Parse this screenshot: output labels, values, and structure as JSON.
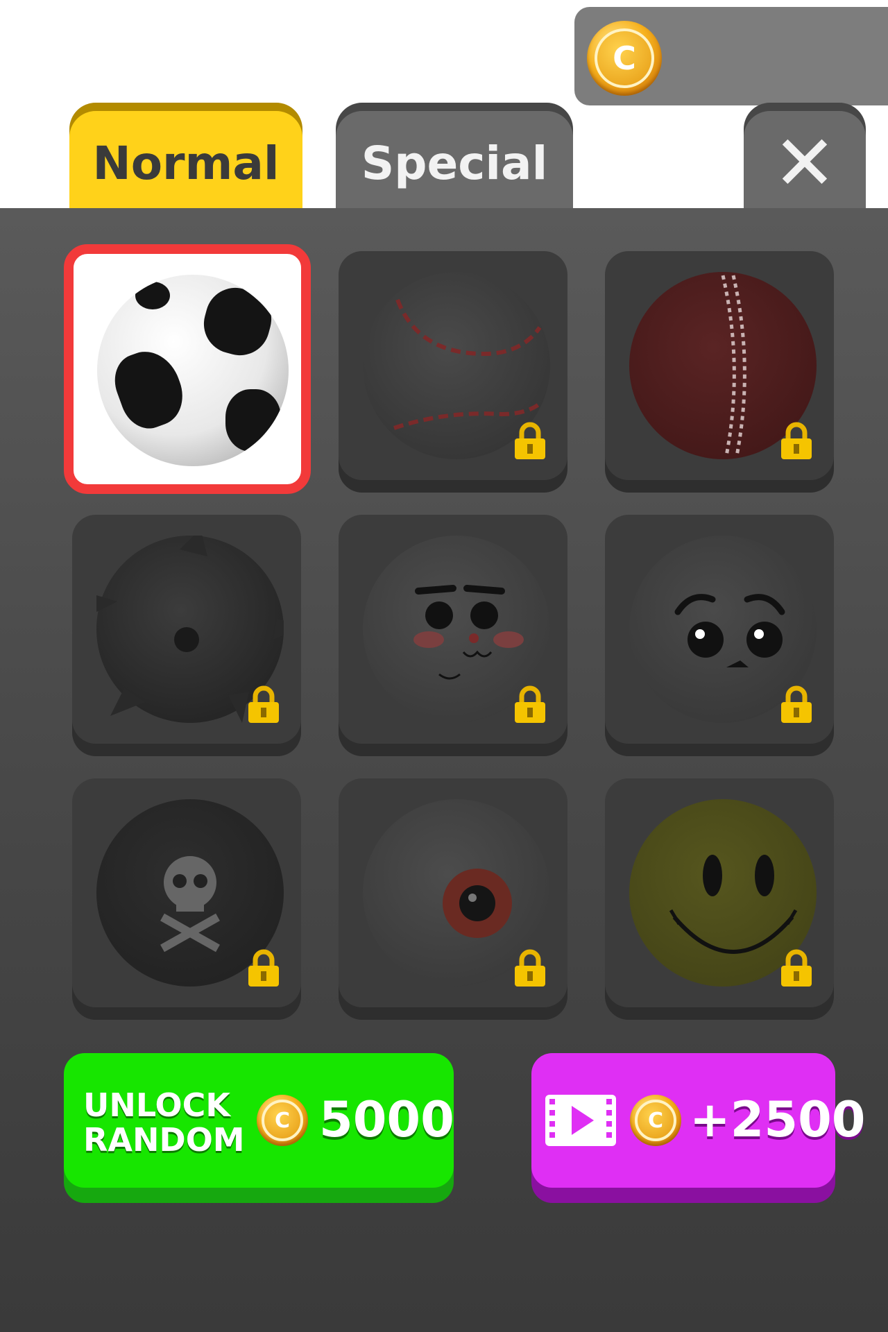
{
  "header": {
    "coin_amount": ""
  },
  "tabs": [
    {
      "label": "Normal",
      "active": true
    },
    {
      "label": "Special",
      "active": false
    }
  ],
  "close_label": "✕",
  "grid": {
    "items": [
      {
        "name": "soccer-ball",
        "locked": false,
        "selected": true
      },
      {
        "name": "baseball",
        "locked": true,
        "selected": false
      },
      {
        "name": "cricket-ball",
        "locked": true,
        "selected": false
      },
      {
        "name": "spiky-ball",
        "locked": true,
        "selected": false
      },
      {
        "name": "cat-face-ball",
        "locked": true,
        "selected": false
      },
      {
        "name": "sad-face-ball",
        "locked": true,
        "selected": false
      },
      {
        "name": "skull-ball",
        "locked": true,
        "selected": false
      },
      {
        "name": "eyeball-ball",
        "locked": true,
        "selected": false
      },
      {
        "name": "smiley-ball",
        "locked": true,
        "selected": false
      }
    ]
  },
  "buttons": {
    "unlock_line1": "UNLOCK",
    "unlock_line2": "RANDOM",
    "unlock_price": "5000",
    "video_reward": "+2500"
  },
  "colors": {
    "tab_active": "#ffd21a",
    "tab_inactive": "#6a6a6a",
    "selected_border": "#f23a3a",
    "unlock_button": "#17e600",
    "video_button": "#df2ff4"
  },
  "icons": [
    "coin-icon",
    "lock-icon",
    "close-icon",
    "video-icon"
  ]
}
